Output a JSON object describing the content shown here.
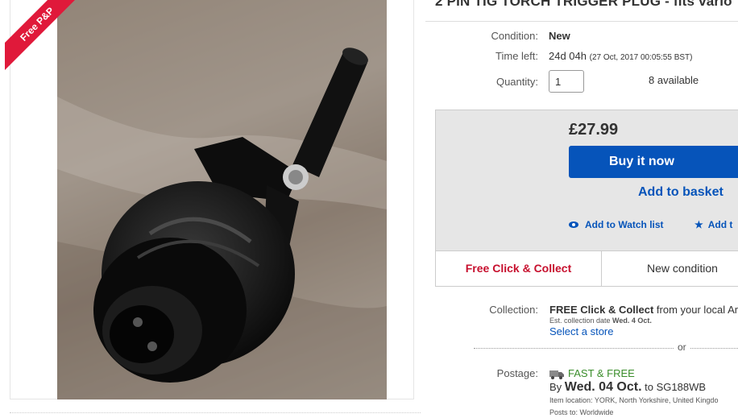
{
  "image": {
    "badge": "Free P&P"
  },
  "listing": {
    "title": "2 PIN TIG TORCH TRIGGER PLUG - fits vario"
  },
  "details": {
    "condition_label": "Condition:",
    "condition_value": "New",
    "time_left_label": "Time left:",
    "time_left_value": "24d 04h",
    "time_left_date": "(27 Oct, 2017   00:05:55 BST)",
    "quantity_label": "Quantity:",
    "quantity_value": "1",
    "available": "8 available"
  },
  "purchase": {
    "price": "£27.99",
    "buy_now": "Buy it now",
    "add_basket": "Add to basket",
    "watch_list": "Add to Watch list",
    "add_collection": "Add t"
  },
  "tabs": {
    "collect": "Free Click & Collect",
    "condition": "New condition"
  },
  "collection": {
    "label": "Collection:",
    "line_bold": "FREE Click & Collect",
    "line_rest": " from your local Ar",
    "est_prefix": "Est. collection date ",
    "est_date": "Wed. 4 Oct.",
    "select_store": "Select a store"
  },
  "or_text": "or",
  "postage": {
    "label": "Postage:",
    "fast_free": "FAST & FREE",
    "by": "By ",
    "date": "Wed. 04 Oct.",
    "to": " to SG188WB",
    "item_location": "Item location:  YORK, North Yorkshire, United Kingdo",
    "posts_to": "Posts to:  Worldwide"
  },
  "colors": {
    "accent_blue": "#0654ba",
    "ribbon_red": "#e0193a",
    "collect_red": "#c7102e",
    "fast_green": "#3a8d2a"
  },
  "icons": [
    "eye-icon",
    "star-icon",
    "truck-icon"
  ]
}
